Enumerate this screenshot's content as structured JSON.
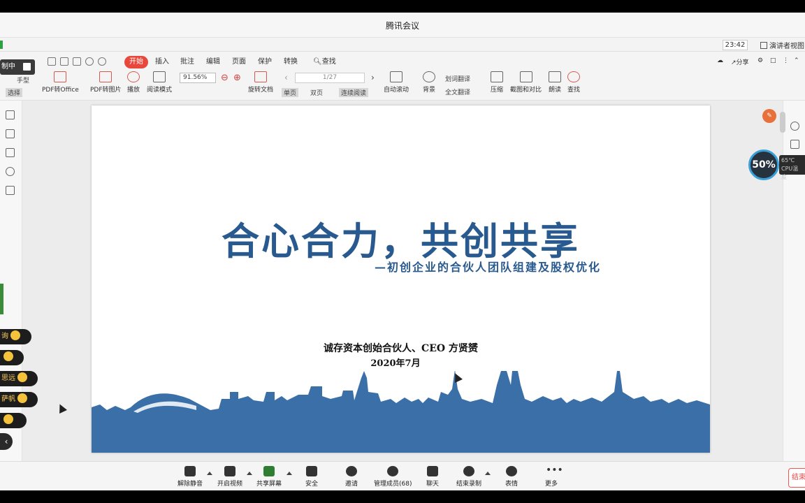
{
  "window": {
    "title": "腾讯会议",
    "time": "23:42",
    "presenter_view": "演讲者视图"
  },
  "ribbon": {
    "tabs": [
      "开始",
      "插入",
      "批注",
      "编辑",
      "页面",
      "保护",
      "转换"
    ],
    "search": "查找",
    "share": "分享",
    "zoom": "91.56%",
    "page": "1/27",
    "tools": [
      "PDF转Office",
      "PDF转图片",
      "播放",
      "阅读模式",
      "旋转文档",
      "自动滚动",
      "背景",
      "划词翻译",
      "全文翻译",
      "压缩",
      "截图和对比",
      "朗读",
      "查找"
    ],
    "view_modes": [
      "单页",
      "双页",
      "连续阅读"
    ],
    "left_modes": [
      "手型",
      "选择"
    ]
  },
  "recording": {
    "label": "制中"
  },
  "slide": {
    "title": "合心合力，共创共享",
    "subtitle": "—初创企业的合伙人团队组建及股权优化",
    "author": "诚存资本创始合伙人、CEO 方贤赟",
    "date": "2020年7月"
  },
  "reactions": [
    {
      "name": "询"
    },
    {
      "name": ""
    },
    {
      "name": "思远"
    },
    {
      "name": "萨帆"
    },
    {
      "name": ""
    }
  ],
  "monitor": {
    "cpu_usage": "50%",
    "temp": "65℃",
    "label": "CPU温度"
  },
  "meeting_toolbar": {
    "buttons": [
      "解除静音",
      "开启视频",
      "共享屏幕",
      "安全",
      "邀请",
      "管理成员(68)",
      "聊天",
      "结束录制",
      "表情",
      "更多"
    ],
    "end": "结束"
  },
  "colors": {
    "slide_title": "#285a8f",
    "skyline": "#3b6fa7",
    "accent_red": "#e8473c"
  }
}
